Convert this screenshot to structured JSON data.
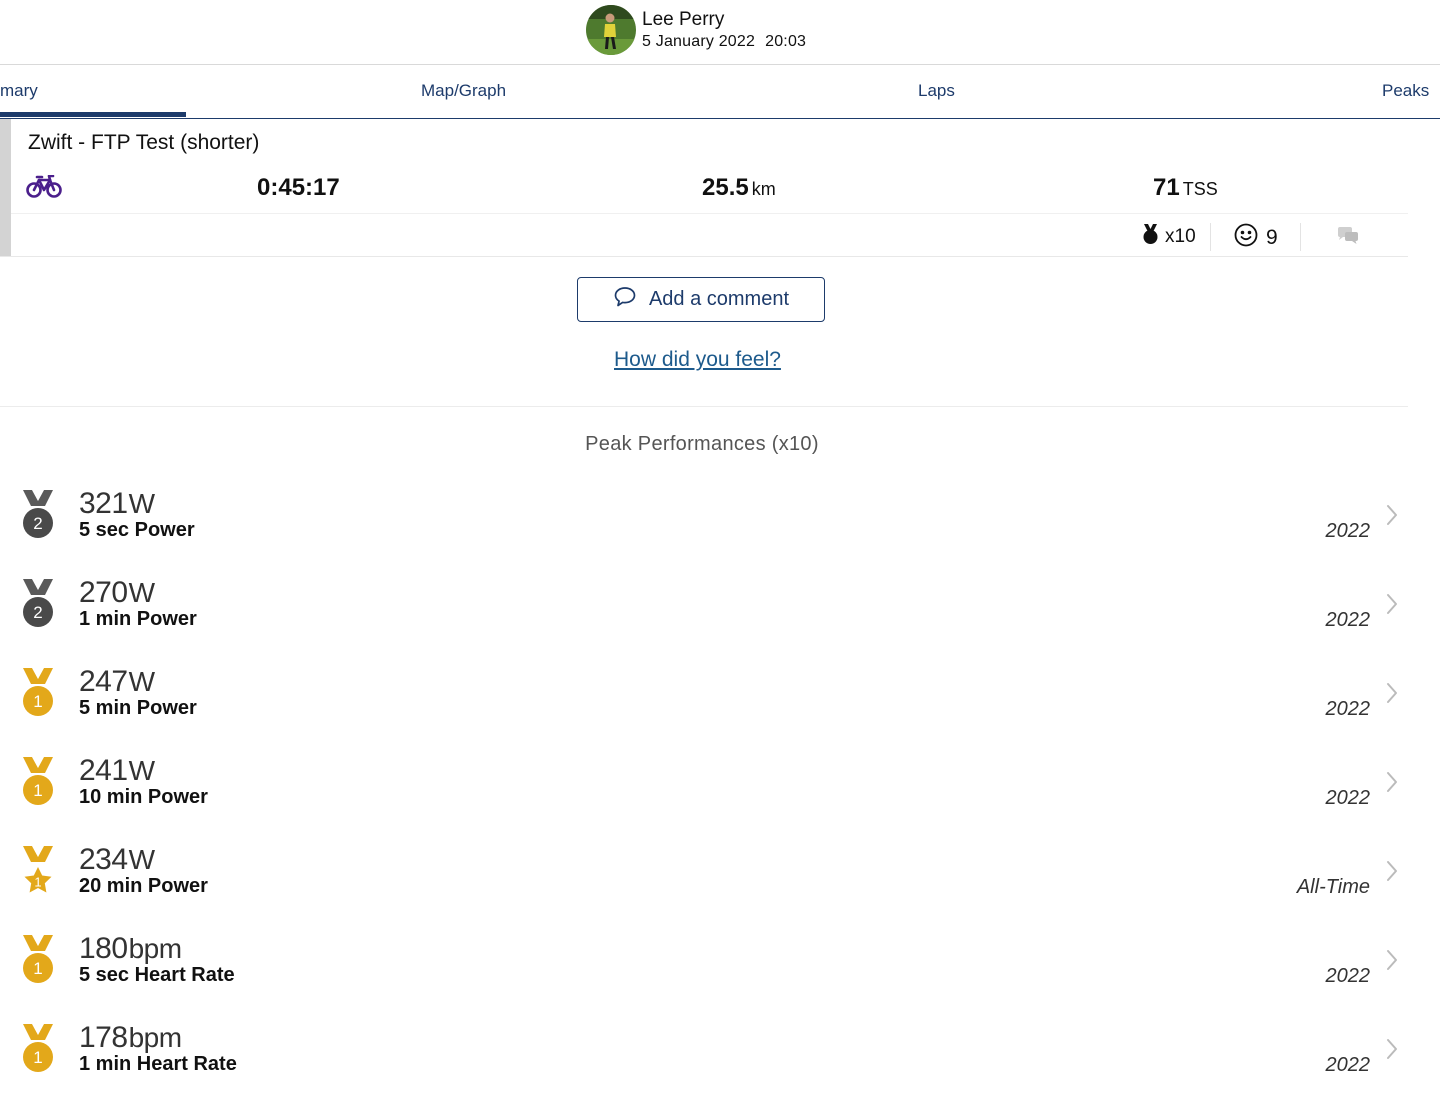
{
  "header": {
    "user_name": "Lee Perry",
    "date": "5 January 2022",
    "time": "20:03"
  },
  "tabs": [
    {
      "label": "mary",
      "active": true
    },
    {
      "label": "Map/Graph",
      "active": false
    },
    {
      "label": "Laps",
      "active": false
    },
    {
      "label": "Peaks",
      "active": false
    }
  ],
  "activity": {
    "title": "Zwift - FTP Test (shorter)",
    "type_icon": "bike-icon",
    "duration": "0:45:17",
    "distance_value": "25.5",
    "distance_unit": "km",
    "tss_value": "71",
    "tss_unit": "TSS",
    "medal_count": "x10",
    "feeling_count": "9",
    "icon_color": "#4b1f8c"
  },
  "comment": {
    "add_label": "Add a comment",
    "feel_link": "How did you feel?"
  },
  "peaks": {
    "title": "Peak Performances (x10)",
    "items": [
      {
        "value": "321",
        "unit": "W",
        "label": "5 sec Power",
        "period": "2022",
        "medal": "silver",
        "rank": "2"
      },
      {
        "value": "270",
        "unit": "W",
        "label": "1 min Power",
        "period": "2022",
        "medal": "silver",
        "rank": "2"
      },
      {
        "value": "247",
        "unit": "W",
        "label": "5 min Power",
        "period": "2022",
        "medal": "gold",
        "rank": "1"
      },
      {
        "value": "241",
        "unit": "W",
        "label": "10 min Power",
        "period": "2022",
        "medal": "gold",
        "rank": "1"
      },
      {
        "value": "234",
        "unit": "W",
        "label": "20 min Power",
        "period": "All-Time",
        "medal": "gold-star",
        "rank": "1"
      },
      {
        "value": "180",
        "unit": "bpm",
        "label": "5 sec Heart Rate",
        "period": "2022",
        "medal": "gold",
        "rank": "1"
      },
      {
        "value": "178",
        "unit": "bpm",
        "label": "1 min Heart Rate",
        "period": "2022",
        "medal": "gold",
        "rank": "1"
      }
    ]
  },
  "colors": {
    "accent": "#1d3b6b",
    "link": "#1d5a8c",
    "gold": "#e3a81a",
    "silver": "#4a4a4a"
  }
}
